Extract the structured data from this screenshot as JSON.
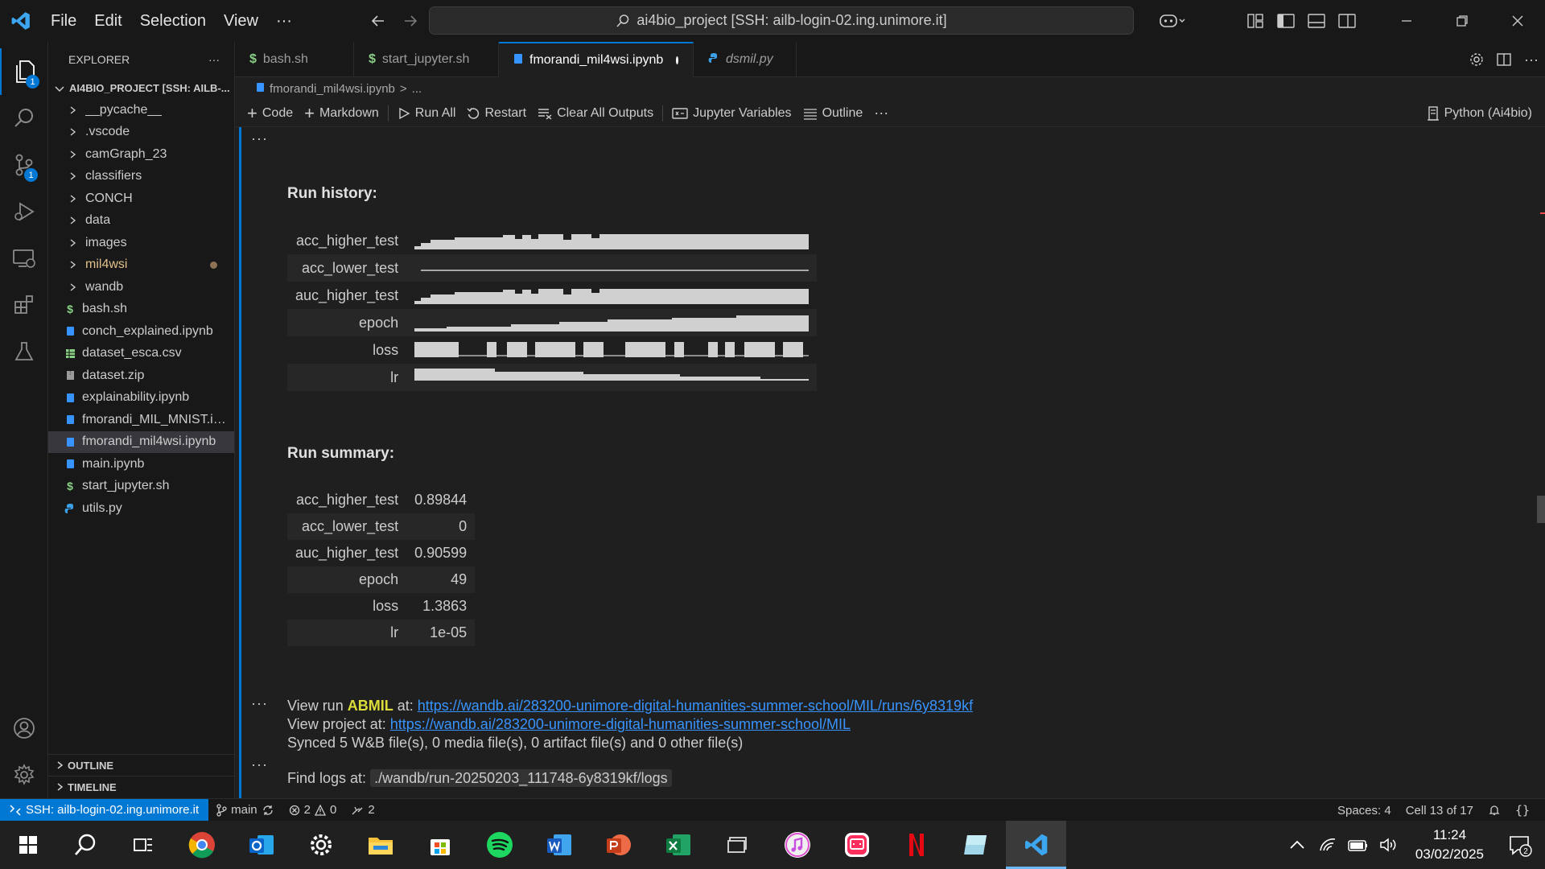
{
  "menu": {
    "items": [
      "File",
      "Edit",
      "Selection",
      "View",
      "···"
    ]
  },
  "command_center": {
    "text": "ai4bio_project [SSH: ailb-login-02.ing.unimore.it]"
  },
  "activity_bar": {
    "explorer_badge": "1",
    "scm_badge": "1"
  },
  "sidebar": {
    "title": "EXPLORER",
    "more": "···",
    "project": "AI4BIO_PROJECT [SSH: AILB-...",
    "items": [
      {
        "label": "__pycache__",
        "type": "folder"
      },
      {
        "label": ".vscode",
        "type": "folder"
      },
      {
        "label": "camGraph_23",
        "type": "folder"
      },
      {
        "label": "classifiers",
        "type": "folder"
      },
      {
        "label": "CONCH",
        "type": "folder"
      },
      {
        "label": "data",
        "type": "folder"
      },
      {
        "label": "images",
        "type": "folder"
      },
      {
        "label": "mil4wsi",
        "type": "folder-modified"
      },
      {
        "label": "wandb",
        "type": "folder"
      },
      {
        "label": "bash.sh",
        "type": "shell"
      },
      {
        "label": "conch_explained.ipynb",
        "type": "notebook"
      },
      {
        "label": "dataset_esca.csv",
        "type": "csv"
      },
      {
        "label": "dataset.zip",
        "type": "zip"
      },
      {
        "label": "explainability.ipynb",
        "type": "notebook"
      },
      {
        "label": "fmorandi_MIL_MNIST.ip...",
        "type": "notebook"
      },
      {
        "label": "fmorandi_mil4wsi.ipynb",
        "type": "notebook-selected"
      },
      {
        "label": "main.ipynb",
        "type": "notebook"
      },
      {
        "label": "start_jupyter.sh",
        "type": "shell"
      },
      {
        "label": "utils.py",
        "type": "python"
      }
    ],
    "outline": "OUTLINE",
    "timeline": "TIMELINE"
  },
  "tabs": [
    {
      "label": "bash.sh",
      "icon": "dollar"
    },
    {
      "label": "start_jupyter.sh",
      "icon": "dollar"
    },
    {
      "label": "fmorandi_mil4wsi.ipynb",
      "icon": "notebook",
      "active": true,
      "modified": true
    },
    {
      "label": "dsmil.py",
      "icon": "python",
      "italic": true
    }
  ],
  "breadcrumb": {
    "file": "fmorandi_mil4wsi.ipynb",
    "sep": ">",
    "more": "..."
  },
  "toolbar": {
    "code": "Code",
    "markdown": "Markdown",
    "run_all": "Run All",
    "restart": "Restart",
    "clear": "Clear All Outputs",
    "variables": "Jupyter Variables",
    "outline": "Outline",
    "more": "···",
    "kernel": "Python (Ai4bio)"
  },
  "output": {
    "ellipsis": "···",
    "history_title": "Run history:",
    "history_rows": [
      {
        "key": "acc_higher_test",
        "spark": "steps-up"
      },
      {
        "key": "acc_lower_test",
        "spark": "flat"
      },
      {
        "key": "auc_higher_test",
        "spark": "steps-up"
      },
      {
        "key": "epoch",
        "spark": "ramp"
      },
      {
        "key": "loss",
        "spark": "blocks"
      },
      {
        "key": "lr",
        "spark": "decay"
      }
    ],
    "summary_title": "Run summary:",
    "summary_rows": [
      {
        "key": "acc_higher_test",
        "value": "0.89844"
      },
      {
        "key": "acc_lower_test",
        "value": "0"
      },
      {
        "key": "auc_higher_test",
        "value": "0.90599"
      },
      {
        "key": "epoch",
        "value": "49"
      },
      {
        "key": "loss",
        "value": "1.3863"
      },
      {
        "key": "lr",
        "value": "1e-05"
      }
    ],
    "view_run_prefix": "View run ",
    "run_name": "ABMIL",
    "view_run_at": " at: ",
    "run_url": "https://wandb.ai/283200-unimore-digital-humanities-summer-school/MIL/runs/6y8319kf",
    "view_project_prefix": "View project at: ",
    "project_url": "https://wandb.ai/283200-unimore-digital-humanities-summer-school/MIL",
    "synced": "Synced 5 W&B file(s), 0 media file(s), 0 artifact file(s) and 0 other file(s)",
    "logs_prefix": "Find logs at: ",
    "logs_path": "./wandb/run-20250203_111748-6y8319kf/logs"
  },
  "statusbar": {
    "remote": "SSH: ailb-login-02.ing.unimore.it",
    "branch": "main",
    "errors": "2",
    "warnings": "0",
    "ports": "2",
    "spaces": "Spaces: 4",
    "cell": "Cell 13 of 17"
  },
  "taskbar": {
    "apps": [
      "start-icon",
      "search-icon",
      "task-view-icon",
      "chrome-icon",
      "outlook-icon",
      "settings-icon",
      "file-explorer-icon",
      "store-icon",
      "spotify-icon",
      "word-icon",
      "powerpoint-icon",
      "excel-icon",
      "remote-desktop-icon",
      "itunes-icon",
      "teams-chat-icon",
      "netflix-icon",
      "app-icon",
      "vscode-icon"
    ],
    "time": "11:24",
    "date": "03/02/2025",
    "notif_count": "2"
  },
  "colors": {
    "accent": "#0078d4",
    "link": "#3794ff",
    "run_name": "#dcdc3a"
  }
}
